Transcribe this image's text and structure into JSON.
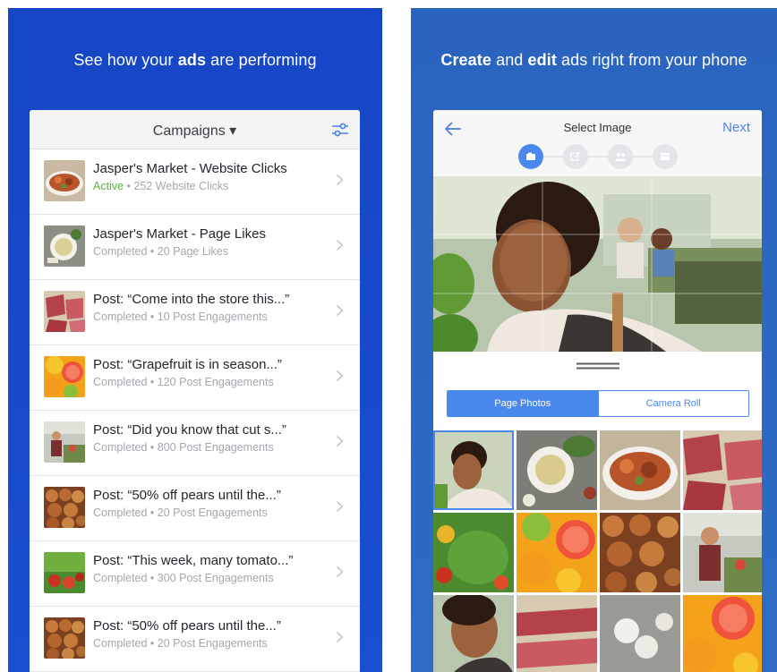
{
  "left": {
    "headline_pre": "See how your ",
    "headline_bold": "ads",
    "headline_post": " are performing",
    "header_title": "Campaigns ▾",
    "campaigns": [
      {
        "name": "Jasper's Market - Website Clicks",
        "status": "Active",
        "detail": " • 252 Website Clicks"
      },
      {
        "name": "Jasper's Market - Page Likes",
        "status": "Completed",
        "detail": " • 20 Page Likes"
      },
      {
        "name": "Post: “Come into the store this...”",
        "status": "Completed",
        "detail": " • 10 Post Engagements"
      },
      {
        "name": "Post: “Grapefruit is in season...”",
        "status": "Completed",
        "detail": " • 120 Post Engagements"
      },
      {
        "name": "Post: “Did you know that cut s...”",
        "status": "Completed",
        "detail": " • 800 Post Engagements"
      },
      {
        "name": "Post: “50% off pears until the...”",
        "status": "Completed",
        "detail": " • 20 Post Engagements"
      },
      {
        "name": "Post: “This week, many tomato...”",
        "status": "Completed",
        "detail": " • 300 Post Engagements"
      },
      {
        "name": "Post: “50% off pears until the...”",
        "status": "Completed",
        "detail": " • 20 Post Engagements"
      }
    ]
  },
  "right": {
    "headline_b1": "Create",
    "headline_mid": " and ",
    "headline_b2": "edit",
    "headline_post": " ads right from your phone",
    "title": "Select Image",
    "next_label": "Next",
    "tab_page_photos": "Page Photos",
    "tab_camera_roll": "Camera Roll"
  },
  "colors": {
    "left_bg": "#1546c5",
    "right_bg": "#2a64bf",
    "accent_blue": "#4a88ee",
    "active_green": "#5ab43a"
  }
}
